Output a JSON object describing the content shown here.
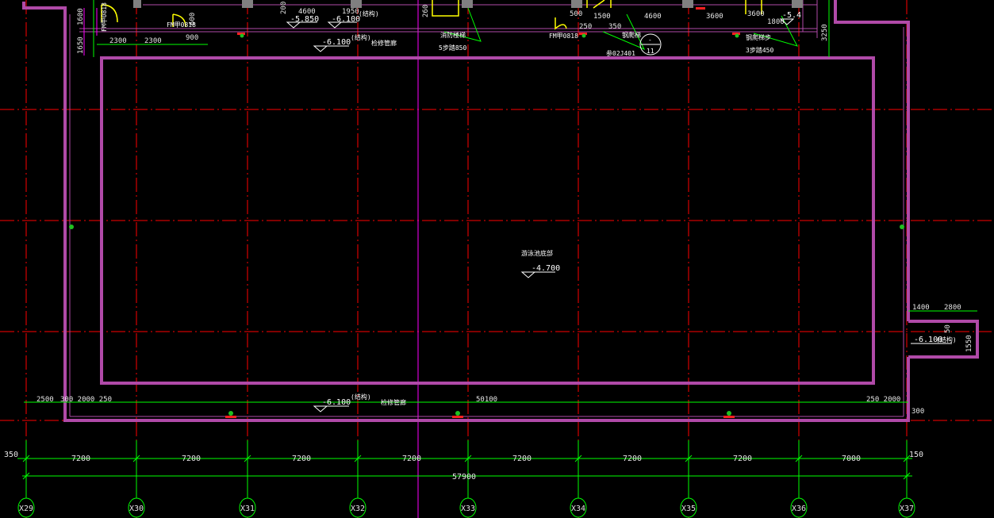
{
  "colors": {
    "background": "#000000",
    "grid": "#ff0000",
    "wall": "#b04aa8",
    "dimension": "#00ff00",
    "symbol": "#ffff00",
    "text": "#ffffff",
    "magenta": "#ff00ff"
  },
  "axes": [
    "X29",
    "X30",
    "X31",
    "X32",
    "X33",
    "X34",
    "X35",
    "X36",
    "X37"
  ],
  "bottom_dims": {
    "left_offset": "350",
    "spans": [
      "7200",
      "7200",
      "7200",
      "7200",
      "7200",
      "7200",
      "7200",
      "7000"
    ],
    "right_offset": "150",
    "total": "57900"
  },
  "inner_dims": {
    "left": [
      "2500",
      "300 2000 250"
    ],
    "mid": "50100",
    "right": "250 2000",
    "right_edge": "300"
  },
  "top_dims": {
    "left_a": "2300",
    "left_b": "2300",
    "left_c": "900",
    "mid_a": "4600",
    "mid_b": "1950",
    "r_a": "500",
    "r_b": "1500",
    "r_c": "4600",
    "r_d": "3600",
    "r_e": "3600",
    "r_f": "1800",
    "r_g": "250",
    "r_h": "350",
    "r_i": "3250",
    "v_a": "1600",
    "v_b": "1650",
    "v_c": "600",
    "v_d": "200",
    "v_e": "260"
  },
  "top_labels": {
    "elev_1": "-5.850",
    "elev_2": "-6.100",
    "elev_2_note": "(结构)",
    "elev_3": "-6.100",
    "elev_3_note": "(结构)",
    "elev_4": "-5.4",
    "note_a": "检修管廊",
    "stair_1": "消防楼梯",
    "stair_1_steps": "5步踏850",
    "stair_2": "钢爬梯",
    "stair_2_ref": "参02J401",
    "stair_3": "钢爬梯步",
    "stair_3_steps": "3步踏450",
    "door_1": "FM甲0818",
    "door_2": "FM甲0818",
    "door_3": "FM甲0818",
    "circle_top": "-",
    "circle_bottom": "11"
  },
  "pool": {
    "name": "游泳池底部",
    "elevation": "-4.700"
  },
  "bottom_labels": {
    "elev": "-6.100",
    "note": "(结构)",
    "pipe": "检修管廊"
  },
  "right_room": {
    "dim_a": "1400",
    "dim_b": "2800",
    "dim_c": "50",
    "dim_d": "1550",
    "elev": "-6.100",
    "note": "(结构)"
  }
}
